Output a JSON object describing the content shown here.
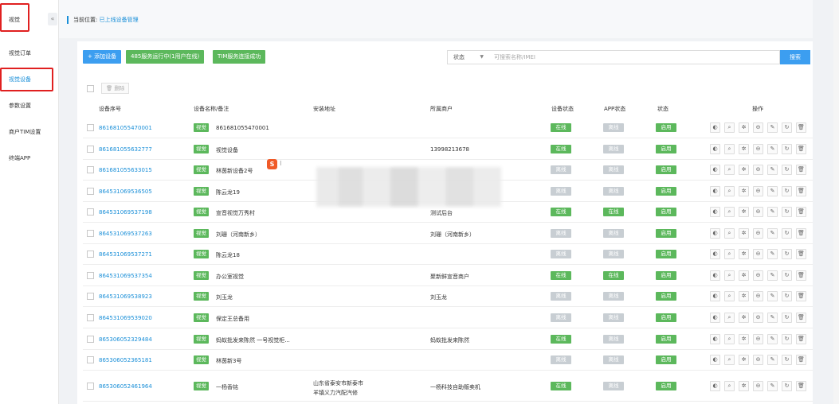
{
  "sidebar": {
    "items": [
      {
        "label": "视觉"
      },
      {
        "label": "视觉订单"
      },
      {
        "label": "视觉设备"
      },
      {
        "label": "参数设置"
      },
      {
        "label": "商户TIM设置"
      },
      {
        "label": "终端APP"
      }
    ],
    "collapse_glyph": "«"
  },
  "breadcrumb": {
    "prefix": "当前位置:",
    "current": "已上线设备管理"
  },
  "toolbar": {
    "add_label": "+ 添加设备",
    "service_label": "485服务运行中(1用户在线)",
    "tim_label": "TIM服务连接成功"
  },
  "search": {
    "status_label": "状态",
    "placeholder": "可搜索名称/IMEI",
    "button_label": "搜索"
  },
  "bulk": {
    "delete_label": "🗑 删除"
  },
  "table": {
    "headers": [
      "设备序号",
      "设备名称/备注",
      "安装地址",
      "所属商户",
      "设备状态",
      "APP状态",
      "状态",
      "操作"
    ],
    "tag_label": "视觉",
    "rows": [
      {
        "imei": "861681055470001",
        "name": "861681055470001",
        "address": "",
        "merchant": "",
        "device_status": "在线",
        "device_on": true,
        "app_status": "离线",
        "app_on": false,
        "state": "启用"
      },
      {
        "imei": "861681055632777",
        "name": "视觉设备",
        "address": "",
        "merchant": "13998213678",
        "device_status": "在线",
        "device_on": true,
        "app_status": "离线",
        "app_on": false,
        "state": "启用"
      },
      {
        "imei": "861681055633015",
        "name": "林茵新设备2号",
        "address": "",
        "merchant": "",
        "device_status": "离线",
        "device_on": false,
        "app_status": "离线",
        "app_on": false,
        "state": "启用"
      },
      {
        "imei": "864531069536505",
        "name": "陈云龙19",
        "address": "",
        "merchant": "",
        "device_status": "离线",
        "device_on": false,
        "app_status": "离线",
        "app_on": false,
        "state": "启用"
      },
      {
        "imei": "864531069537198",
        "name": "宣音视觉万秀村",
        "address": "",
        "merchant": "测试后台",
        "device_status": "在线",
        "device_on": true,
        "app_status": "在线",
        "app_on": true,
        "state": "启用"
      },
      {
        "imei": "864531069537263",
        "name": "刘珊（河南新乡）",
        "address": "",
        "merchant": "刘珊（河南新乡）",
        "device_status": "离线",
        "device_on": false,
        "app_status": "离线",
        "app_on": false,
        "state": "启用"
      },
      {
        "imei": "864531069537271",
        "name": "陈云龙18",
        "address": "",
        "merchant": "",
        "device_status": "离线",
        "device_on": false,
        "app_status": "离线",
        "app_on": false,
        "state": "启用"
      },
      {
        "imei": "864531069537354",
        "name": "办公室视觉",
        "address": "",
        "merchant": "聚新鲜宣音商户",
        "device_status": "在线",
        "device_on": true,
        "app_status": "在线",
        "app_on": true,
        "state": "启用"
      },
      {
        "imei": "864531069538923",
        "name": "刘玉龙",
        "address": "",
        "merchant": "刘玉龙",
        "device_status": "离线",
        "device_on": false,
        "app_status": "离线",
        "app_on": false,
        "state": "启用"
      },
      {
        "imei": "864531069539020",
        "name": "保定王总备用",
        "address": "",
        "merchant": "",
        "device_status": "离线",
        "device_on": false,
        "app_status": "离线",
        "app_on": false,
        "state": "启用"
      },
      {
        "imei": "865306052329484",
        "name": "蚂蚁批发来陈然 一号视觉柜...",
        "address": "",
        "merchant": "蚂蚁批发来陈然",
        "device_status": "在线",
        "device_on": true,
        "app_status": "离线",
        "app_on": false,
        "state": "启用"
      },
      {
        "imei": "865306052365181",
        "name": "林茵新3号",
        "address": "",
        "merchant": "",
        "device_status": "离线",
        "device_on": false,
        "app_status": "离线",
        "app_on": false,
        "state": "启用"
      },
      {
        "imei": "865306052461964",
        "name": "一杨香铭",
        "address": "山东省泰安市新泰市 羊镇义力汽配汽修",
        "merchant": "一杨科技自助贩卖机",
        "device_status": "在线",
        "device_on": true,
        "app_status": "离线",
        "app_on": false,
        "state": "启用"
      }
    ]
  },
  "op_icons": [
    {
      "name": "palette-icon",
      "glyph": "◐"
    },
    {
      "name": "search-icon",
      "glyph": "⌕"
    },
    {
      "name": "gear-icon",
      "glyph": "✲"
    },
    {
      "name": "minus-circle-icon",
      "glyph": "⊖"
    },
    {
      "name": "edit-icon",
      "glyph": "✎"
    },
    {
      "name": "refresh-icon",
      "glyph": "↻"
    },
    {
      "name": "trash-icon",
      "glyph": "🗑"
    }
  ],
  "colors": {
    "accent": "#1a8fd8",
    "green": "#5cb85c",
    "offline": "#c8ced3",
    "highlight": "#e02020"
  }
}
